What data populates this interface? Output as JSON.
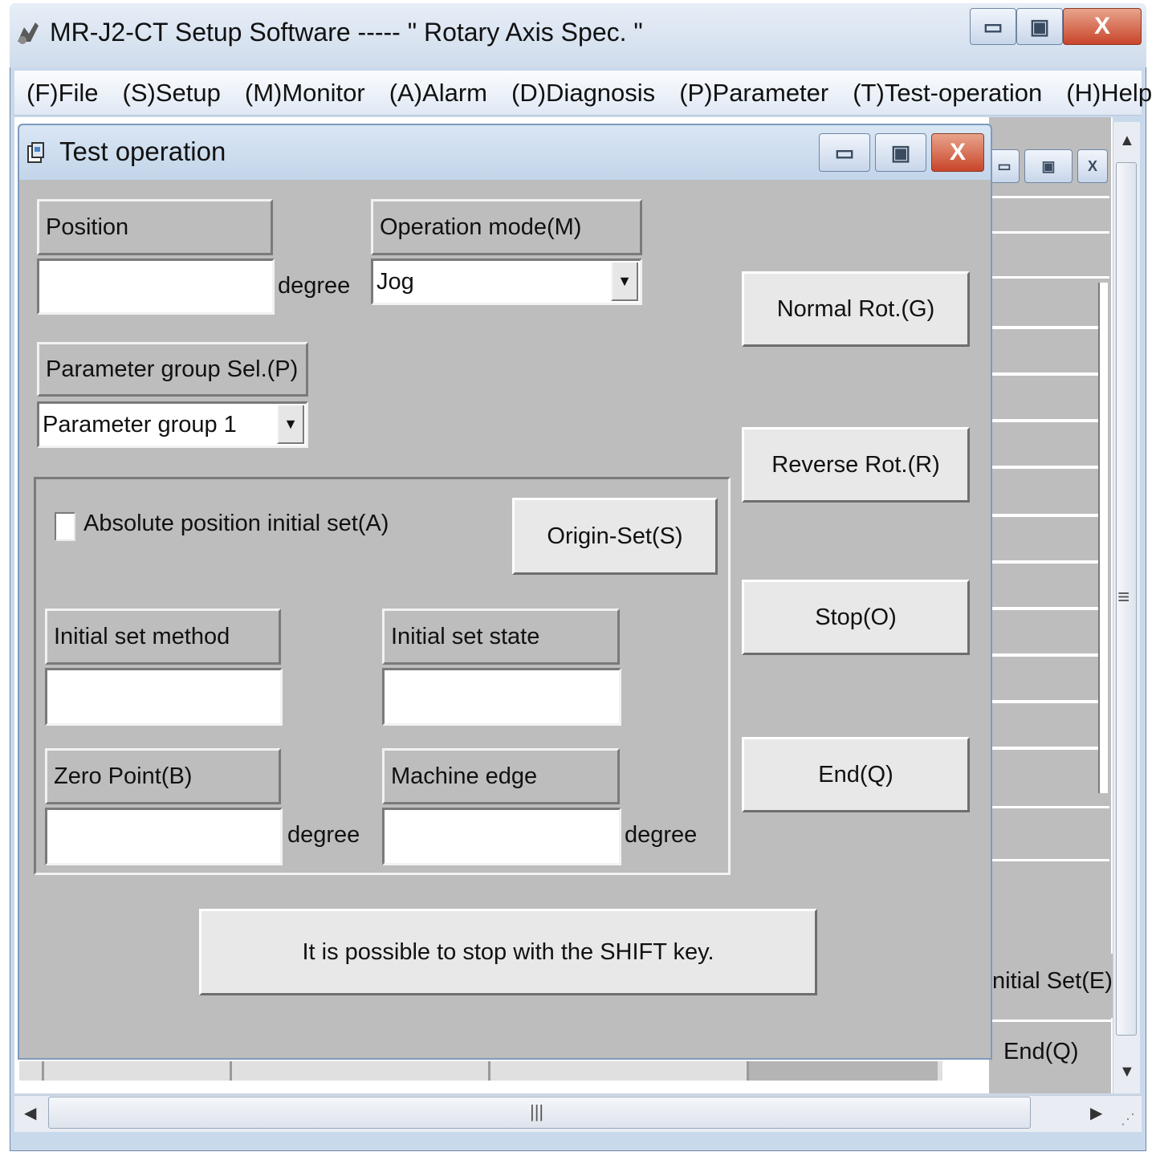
{
  "app": {
    "title": "MR-J2-CT Setup Software -----  \" Rotary Axis Spec. \""
  },
  "window_buttons": {
    "minimize": "▭",
    "maximize": "▣",
    "close": "X"
  },
  "menu": [
    {
      "label": "(F)File"
    },
    {
      "label": "(S)Setup"
    },
    {
      "label": "(M)Monitor"
    },
    {
      "label": "(A)Alarm"
    },
    {
      "label": "(D)Diagnosis"
    },
    {
      "label": "(P)Parameter"
    },
    {
      "label": "(T)Test-operation"
    },
    {
      "label": "(H)Help"
    }
  ],
  "dialog": {
    "title": "Test operation",
    "position": {
      "label": "Position",
      "value": "",
      "unit": "degree"
    },
    "operation_mode": {
      "label": "Operation mode(M)",
      "selected": "Jog"
    },
    "parameter_group": {
      "label": "Parameter group Sel.(P)",
      "selected": "Parameter group 1"
    },
    "absolute_init": {
      "label": "Absolute position initial set(A)",
      "checked": false
    },
    "origin_set_button": "Origin-Set(S)",
    "initial_set_method": {
      "label": "Initial set method",
      "value": ""
    },
    "initial_set_state": {
      "label": "Initial set state",
      "value": ""
    },
    "zero_point": {
      "label": "Zero Point(B)",
      "value": "",
      "unit": "degree"
    },
    "machine_edge": {
      "label": "Machine edge",
      "value": "",
      "unit": "degree"
    },
    "buttons": {
      "normal_rot": "Normal  Rot.(G)",
      "reverse_rot": "Reverse Rot.(R)",
      "stop": "Stop(O)",
      "end": "End(Q)"
    },
    "hint": "It is possible to stop with the SHIFT key."
  },
  "background_window": {
    "initial_set_button": "nitial Set(E)",
    "end_button": "End(Q)"
  },
  "scrollbar": {
    "grip": "≡",
    "hgrip": "|||"
  },
  "colors": {
    "dialog_bg": "#bdbdbd",
    "title_bar": "#cfdcec",
    "close_button": "#c8452a"
  }
}
